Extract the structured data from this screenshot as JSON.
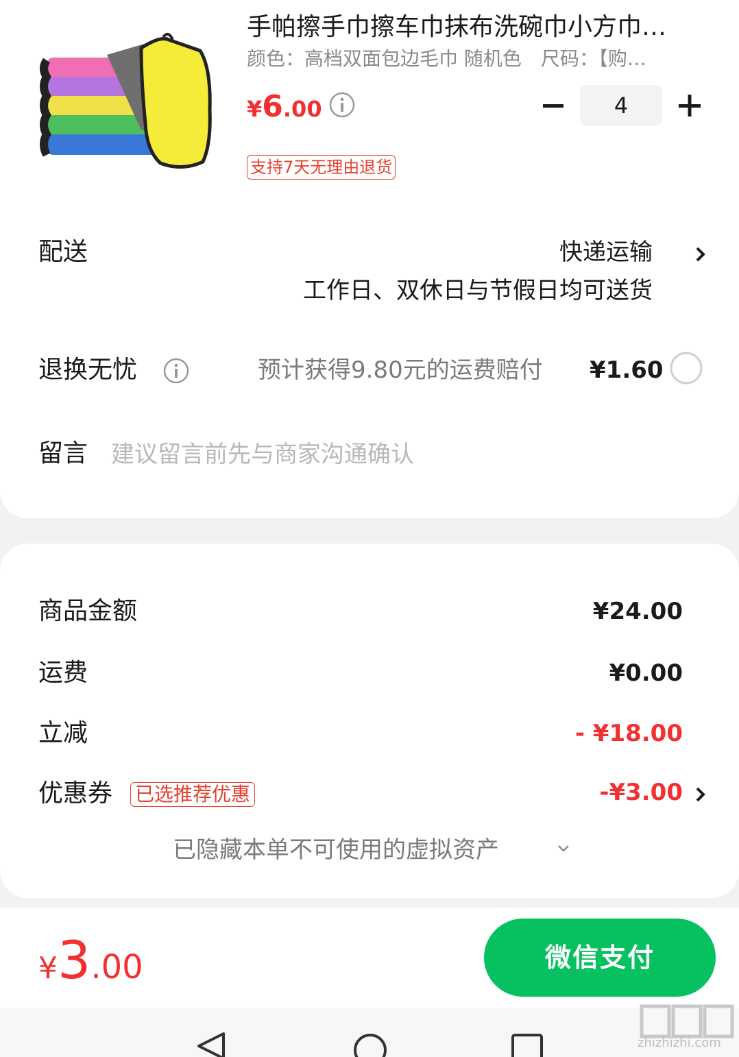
{
  "product": {
    "title": "手帕擦手巾擦车巾抹布洗碗巾小方巾…",
    "spec": "颜色：高档双面包边毛巾 随机色　尺码：【购…",
    "price": {
      "currency": "¥",
      "integer": "6",
      "decimal": ".00"
    },
    "quantity": "4",
    "return_badge": "支持7天无理由退货"
  },
  "delivery": {
    "label": "配送",
    "method": "快递运输",
    "note": "工作日、双休日与节假日均可送货"
  },
  "return_insurance": {
    "label": "退换无忧",
    "description": "预计获得9.80元的运费赔付",
    "price": "¥1.60"
  },
  "message": {
    "label": "留言",
    "placeholder": "建议留言前先与商家沟通确认"
  },
  "summary": {
    "goods_label": "商品金额",
    "goods_value": "¥24.00",
    "shipping_label": "运费",
    "shipping_value": "¥0.00",
    "discount_label": "立减",
    "discount_value": "- ¥18.00",
    "coupon_label": "优惠券",
    "coupon_badge": "已选推荐优惠",
    "coupon_value": "-¥3.00",
    "hidden_assets": "已隐藏本单不可使用的虚拟资产"
  },
  "footer": {
    "total": {
      "currency": "¥",
      "integer": "3",
      "decimal": ".00"
    },
    "pay_button": "微信支付"
  },
  "watermark": {
    "text": "zhizhizhi.com"
  },
  "colors": {
    "accent_red": "#f23030",
    "pay_green": "#07c160",
    "background": "#f2f2f2"
  }
}
